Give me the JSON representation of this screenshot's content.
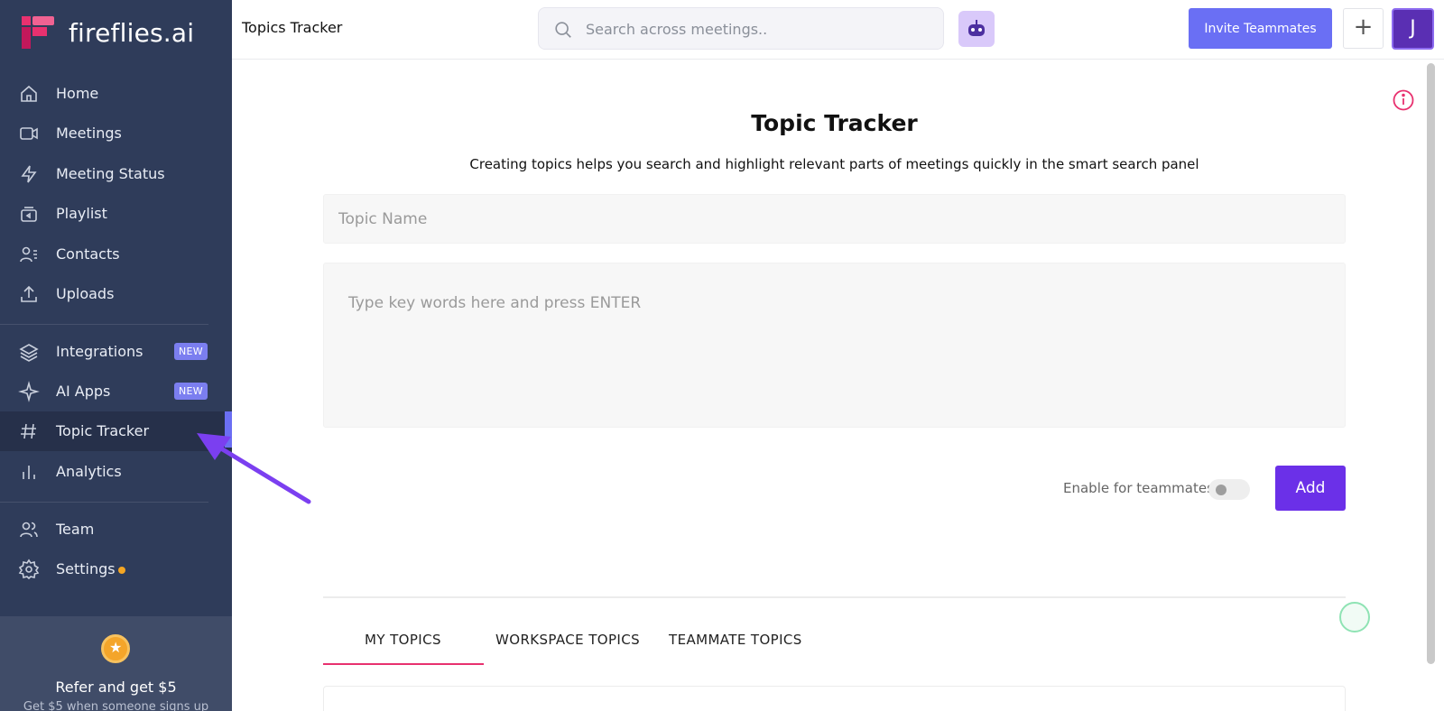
{
  "app": {
    "name": "fireflies.ai"
  },
  "sidebar": {
    "items": [
      {
        "label": "Home",
        "icon": "home-icon"
      },
      {
        "label": "Meetings",
        "icon": "video-icon"
      },
      {
        "label": "Meeting Status",
        "icon": "lightning-icon"
      },
      {
        "label": "Playlist",
        "icon": "playlist-icon"
      },
      {
        "label": "Contacts",
        "icon": "contacts-icon"
      },
      {
        "label": "Uploads",
        "icon": "upload-icon"
      },
      {
        "label": "Integrations",
        "icon": "layers-icon",
        "badge": "NEW"
      },
      {
        "label": "AI Apps",
        "icon": "sparkle-icon",
        "badge": "NEW"
      },
      {
        "label": "Topic Tracker",
        "icon": "hash-icon",
        "active": true
      },
      {
        "label": "Analytics",
        "icon": "bar-chart-icon"
      },
      {
        "label": "Team",
        "icon": "team-icon"
      },
      {
        "label": "Settings",
        "icon": "gear-icon"
      }
    ],
    "refer": {
      "title": "Refer and get $5",
      "subtitle": "Get $5 when someone signs up"
    }
  },
  "header": {
    "page_title": "Topics Tracker",
    "search_placeholder": "Search across meetings..",
    "invite_label": "Invite Teammates",
    "plus_label": "+",
    "avatar_initial": "J"
  },
  "main": {
    "title": "Topic Tracker",
    "subtitle": "Creating topics helps you search and highlight relevant parts of meetings quickly in the smart search panel",
    "topic_name_placeholder": "Topic Name",
    "keywords_placeholder": "Type key words here and press ENTER",
    "enable_label": "Enable for teammates",
    "enable_toggle": false,
    "add_label": "Add",
    "tabs": [
      {
        "label": "MY TOPICS",
        "active": true
      },
      {
        "label": "WORKSPACE TOPICS"
      },
      {
        "label": "TEAMMATE TOPICS"
      }
    ]
  },
  "colors": {
    "sidebar_bg": "#2f3c5a",
    "accent": "#6a6ff4",
    "add_button": "#6b30e8",
    "tab_underline": "#e8316f",
    "badge": "#7b7ef0"
  }
}
